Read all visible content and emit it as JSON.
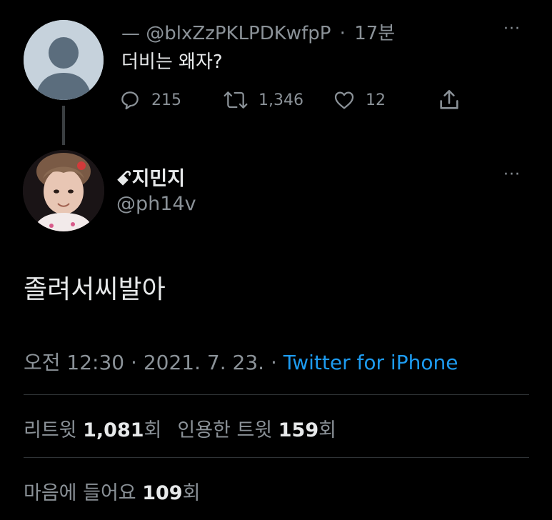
{
  "parent_tweet": {
    "author_display": "—",
    "handle": "@blxZzPKLPDKwfpP",
    "time_ago": "17분",
    "text": "더비는 왜자?",
    "more": "···",
    "replies": "215",
    "retweets": "1,346",
    "likes": "12"
  },
  "tweet": {
    "display_name": "ꗃ지민지",
    "username": "@ph14v",
    "more": "···",
    "text": "졸려서씨발아",
    "time": "오전 12:30",
    "date": "2021. 7. 23.",
    "source": "Twitter for iPhone"
  },
  "stats": {
    "retweets_label": "리트윗",
    "retweets_value": "1,081",
    "retweets_unit": "회",
    "quotes_label": "인용한 트윗",
    "quotes_value": "159",
    "quotes_unit": "회",
    "likes_label": "마음에 들어요",
    "likes_value": "109",
    "likes_unit": "회"
  },
  "colors": {
    "background": "#000000",
    "text_primary": "#e7e9ea",
    "text_secondary": "#8b9298",
    "link": "#1d9bf0",
    "divider": "#2f3336"
  }
}
